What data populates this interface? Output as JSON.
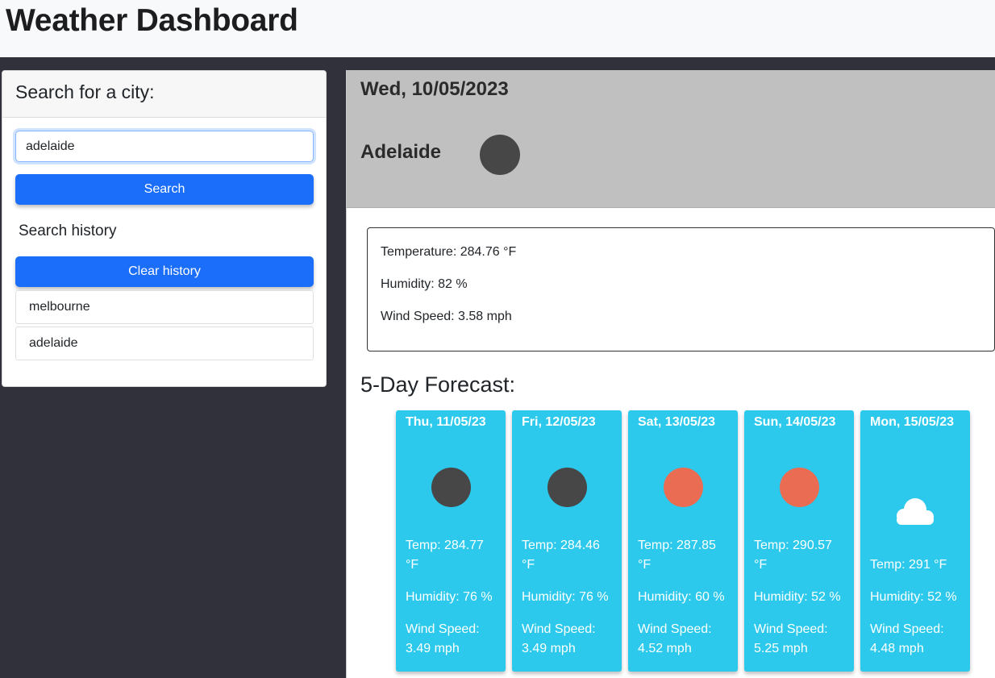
{
  "app": {
    "title": "Weather Dashboard"
  },
  "search": {
    "header": "Search for a city:",
    "input_value": "adelaide",
    "button_label": "Search",
    "history_heading": "Search history",
    "clear_label": "Clear history",
    "history": [
      "melbourne",
      "adelaide"
    ]
  },
  "current": {
    "date": "Wed, 10/05/2023",
    "city": "Adelaide",
    "icon": "dark-circle-icon",
    "temperature": "Temperature: 284.76 °F",
    "humidity": "Humidity: 82 %",
    "wind": "Wind Speed: 3.58 mph"
  },
  "forecast": {
    "title": "5-Day Forecast:",
    "days": [
      {
        "date": "Thu, 11/05/23",
        "icon": "dark-circle-icon",
        "icon_color": "#474747",
        "temp": "Temp: 284.77 °F",
        "humidity": "Humidity: 76 %",
        "wind": "Wind Speed: 3.49 mph"
      },
      {
        "date": "Fri, 12/05/23",
        "icon": "dark-circle-icon",
        "icon_color": "#474747",
        "temp": "Temp: 284.46 °F",
        "humidity": "Humidity: 76 %",
        "wind": "Wind Speed: 3.49 mph"
      },
      {
        "date": "Sat, 13/05/23",
        "icon": "sun-icon",
        "icon_color": "#ea6c53",
        "temp": "Temp: 287.85 °F",
        "humidity": "Humidity: 60 %",
        "wind": "Wind Speed: 4.52 mph"
      },
      {
        "date": "Sun, 14/05/23",
        "icon": "sun-icon",
        "icon_color": "#ea6c53",
        "temp": "Temp: 290.57 °F",
        "humidity": "Humidity: 52 %",
        "wind": "Wind Speed: 5.25 mph"
      },
      {
        "date": "Mon, 15/05/23",
        "icon": "cloud-icon",
        "icon_color": "#ffffff",
        "temp": "Temp: 291 °F",
        "humidity": "Humidity: 52 %",
        "wind": "Wind Speed: 4.48 mph"
      }
    ]
  },
  "colors": {
    "primary": "#1b6ef9",
    "forecast_card": "#2cc9ec",
    "current_header": "#c0c0c0",
    "page_bg": "#30313b"
  }
}
